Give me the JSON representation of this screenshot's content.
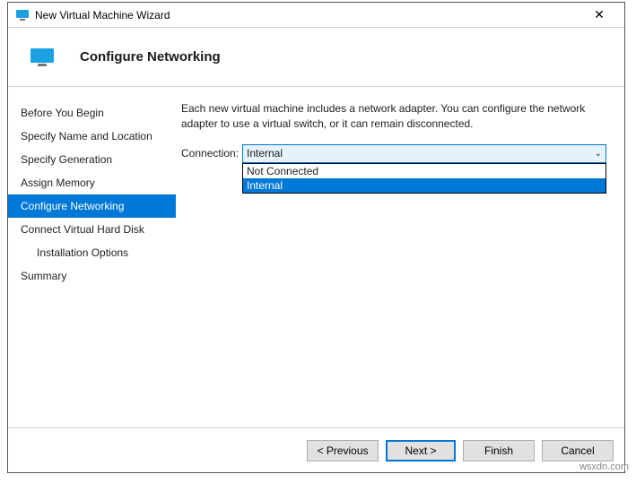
{
  "window": {
    "title": "New Virtual Machine Wizard"
  },
  "header": {
    "title": "Configure Networking"
  },
  "sidebar": {
    "items": [
      {
        "label": "Before You Begin"
      },
      {
        "label": "Specify Name and Location"
      },
      {
        "label": "Specify Generation"
      },
      {
        "label": "Assign Memory"
      },
      {
        "label": "Configure Networking"
      },
      {
        "label": "Connect Virtual Hard Disk"
      },
      {
        "label": "Installation Options"
      },
      {
        "label": "Summary"
      }
    ]
  },
  "content": {
    "description": "Each new virtual machine includes a network adapter. You can configure the network adapter to use a virtual switch, or it can remain disconnected.",
    "connection_label": "Connection:",
    "selected": "Internal",
    "options": {
      "not_connected": "Not Connected",
      "internal": "Internal"
    }
  },
  "footer": {
    "previous": "< Previous",
    "next": "Next >",
    "finish": "Finish",
    "cancel": "Cancel"
  },
  "watermark": "wsxdn.com"
}
